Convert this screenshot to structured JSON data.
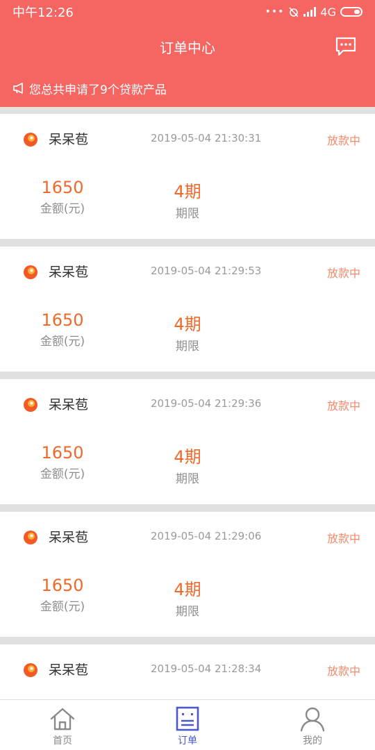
{
  "status_bar": {
    "time": "中午12:26",
    "network": "4G"
  },
  "header": {
    "title": "订单中心"
  },
  "notice": {
    "text": "您总共申请了9个贷款产品"
  },
  "orders": [
    {
      "name": "呆呆苞",
      "time": "2019-05-04 21:30:31",
      "status": "放款中",
      "amount": "1650",
      "amount_label": "金额(元)",
      "term": "4期",
      "term_label": "期限"
    },
    {
      "name": "呆呆苞",
      "time": "2019-05-04 21:29:53",
      "status": "放款中",
      "amount": "1650",
      "amount_label": "金额(元)",
      "term": "4期",
      "term_label": "期限"
    },
    {
      "name": "呆呆苞",
      "time": "2019-05-04 21:29:36",
      "status": "放款中",
      "amount": "1650",
      "amount_label": "金额(元)",
      "term": "4期",
      "term_label": "期限"
    },
    {
      "name": "呆呆苞",
      "time": "2019-05-04 21:29:06",
      "status": "放款中",
      "amount": "1650",
      "amount_label": "金额(元)",
      "term": "4期",
      "term_label": "期限"
    },
    {
      "name": "呆呆苞",
      "time": "2019-05-04 21:28:34",
      "status": "放款中"
    }
  ],
  "tabbar": {
    "tabs": [
      {
        "label": "首页",
        "icon": "home-icon"
      },
      {
        "label": "订单",
        "icon": "order-icon",
        "active": true
      },
      {
        "label": "我的",
        "icon": "profile-icon"
      }
    ]
  },
  "colors": {
    "brand": "#f56562",
    "amount": "#ef6a2a",
    "status": "#f38a6c",
    "active_tab": "#4a58c8"
  }
}
